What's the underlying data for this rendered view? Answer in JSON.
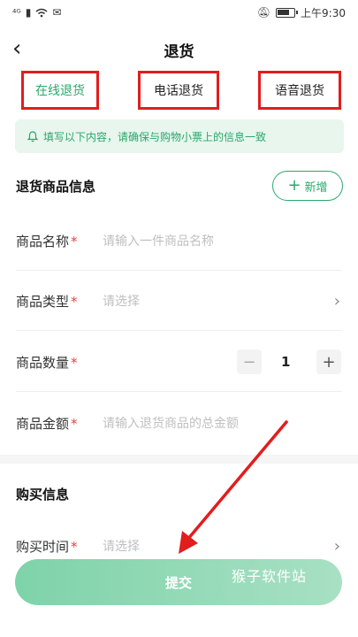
{
  "status_bar": {
    "signal": "⁴ᴳ",
    "time": "上午9:30"
  },
  "nav": {
    "back_icon": "chevron-left-icon",
    "title": "退货"
  },
  "tabs": [
    {
      "label": "在线退货",
      "active": true
    },
    {
      "label": "电话退货",
      "active": false
    },
    {
      "label": "语音退货",
      "active": false
    }
  ],
  "notice": {
    "icon": "bell-icon",
    "text": "填写以下内容，请确保与购物小票上的信息一致"
  },
  "goods_section": {
    "title": "退货商品信息",
    "add_label": "新增",
    "fields": [
      {
        "label": "商品名称",
        "placeholder": "请输入一件商品名称"
      },
      {
        "label": "商品类型",
        "placeholder": "请选择"
      },
      {
        "label": "商品数量",
        "quantity": "1"
      },
      {
        "label": "商品金额",
        "placeholder": "请输入退货商品的总金额"
      }
    ]
  },
  "purchase_section": {
    "title": "购买信息",
    "fields": [
      {
        "label": "购买时间",
        "placeholder": "请选择"
      }
    ]
  },
  "submit_label": "提交",
  "watermark": "猴子软件站",
  "colors": {
    "accent": "#2aa86b",
    "annotation_red": "#e21d1d",
    "required": "#e24444"
  }
}
